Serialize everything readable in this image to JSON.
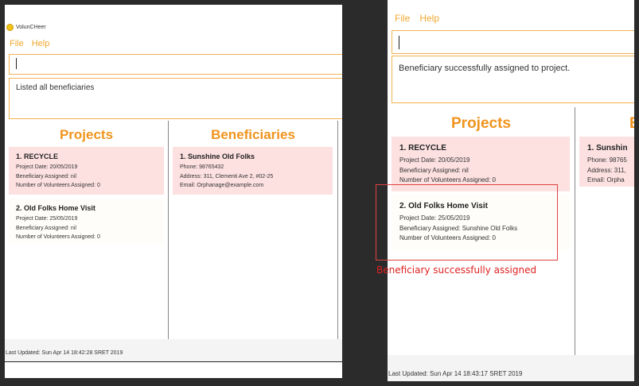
{
  "app": {
    "title": "VolunCHeer"
  },
  "menu": {
    "file": "File",
    "help": "Help"
  },
  "left": {
    "result": "Listed all beneficiaries",
    "projects_title": "Projects",
    "beneficiaries_title": "Beneficiaries",
    "projects": [
      {
        "title": "1.  RECYCLE",
        "date": "Project Date: 20/05/2019",
        "beneficiary": "Beneficiary Assigned: nil",
        "volunteers": "Number of Volunteers Assigned: 0"
      },
      {
        "title": "2.  Old Folks Home Visit",
        "date": "Project Date: 25/05/2019",
        "beneficiary": "Beneficiary Assigned: nil",
        "volunteers": "Number of Volunteers Assigned: 0"
      }
    ],
    "beneficiaries": [
      {
        "title": "1.  Sunshine Old Folks",
        "phone": "Phone: 98765432",
        "address": "Address: 311, Clementi Ave 2, #02-25",
        "email": "Email: Orphanage@example.com"
      }
    ],
    "status": "Last Updated: Sun Apr 14 18:42:28 SRET 2019"
  },
  "right": {
    "result": "Beneficiary successfully assigned to project.",
    "projects_title": "Projects",
    "beneficiaries_title_partial": "B",
    "projects": [
      {
        "title": "1.  RECYCLE",
        "date": "Project Date: 20/05/2019",
        "beneficiary": "Beneficiary Assigned: nil",
        "volunteers": "Number of Volunteers Assigned: 0"
      },
      {
        "title": "2.  Old Folks Home Visit",
        "date": "Project Date: 25/05/2019",
        "beneficiary": "Beneficiary Assigned: Sunshine Old Folks",
        "volunteers": "Number of Volunteers Assigned: 0"
      }
    ],
    "beneficiary_partial": {
      "title": "1.  Sunshin",
      "phone": "Phone: 98765",
      "address": "Address: 311,",
      "email": "Email: Orpha"
    },
    "status": "Last Updated: Sun Apr 14 18:43:17 SRET 2019",
    "annotation": "Beneficiary successfully assigned"
  },
  "colors": {
    "accent": "#f0941e",
    "card_pink": "#fde0e0",
    "annotation_red": "#e02020",
    "box_border": "#f1b252"
  }
}
